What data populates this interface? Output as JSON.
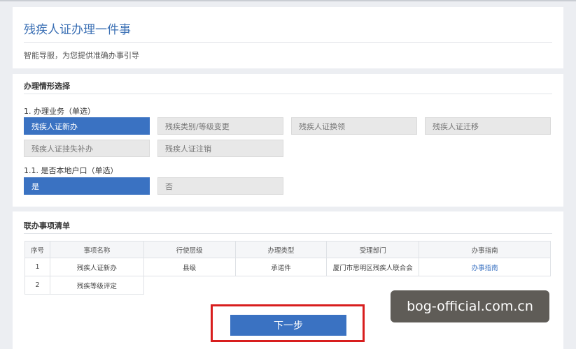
{
  "header": {
    "title": "残疾人证办理一件事",
    "subtitle": "智能导服，为您提供准确办事引导"
  },
  "situation": {
    "section_title": "办理情形选择",
    "q1": {
      "label": "1. 办理业务（单选）",
      "options": [
        "残疾人证新办",
        "残疾类别/等级变更",
        "残疾人证换领",
        "残疾人证迁移",
        "残疾人证挂失补办",
        "残疾人证注销"
      ],
      "selected": "残疾人证新办"
    },
    "q2": {
      "label": "1.1. 是否本地户口（单选）",
      "options": [
        "是",
        "否"
      ],
      "selected": "是"
    }
  },
  "joint_list": {
    "section_title": "联办事项清单",
    "columns": [
      "序号",
      "事项名称",
      "行使层级",
      "办理类型",
      "受理部门",
      "办事指南"
    ],
    "rows": [
      [
        "1",
        "残疾人证新办",
        "县级",
        "承诺件",
        "厦门市思明区残疾人联合会",
        "办事指南"
      ],
      [
        "2",
        "残疾等级评定",
        "",
        "",
        "",
        ""
      ]
    ]
  },
  "actions": {
    "next_label": "下一步"
  },
  "watermark": "bog-official.com.cn",
  "colors": {
    "accent": "#3a72c2",
    "title": "#3a6fb4",
    "highlight_box": "#d81e1e"
  }
}
